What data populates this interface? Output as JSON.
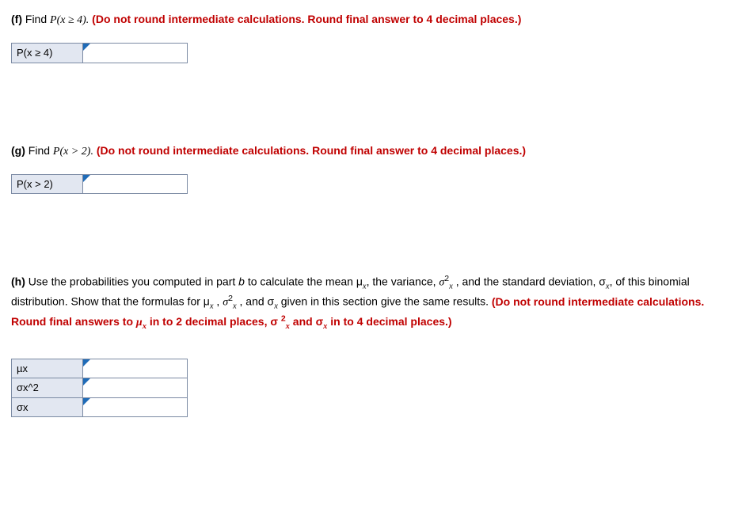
{
  "partF": {
    "label": "(f)",
    "static1": "Find ",
    "expr": "P(x ≥ 4).",
    "instruction": " (Do not round intermediate calculations. Round final answer to 4 decimal places.)",
    "cellLabel": "P(x ≥ 4)",
    "value": ""
  },
  "partG": {
    "label": "(g)",
    "static1": "Find ",
    "expr": "P(x > 2).",
    "instruction": " (Do not round intermediate calculations. Round final answer to 4 decimal places.)",
    "cellLabel": "P(x > 2)",
    "value": ""
  },
  "partH": {
    "label": "(h)",
    "text1": "Use the probabilities you computed in part ",
    "bRef": "b",
    "text2": " to calculate the mean μ",
    "sub_x1": "x",
    "text2b": ", the variance, ",
    "sigma2": "σ",
    "sigma2_sup": "2",
    "sigma2_sub": "x",
    "text3": " , and the standard deviation, σ",
    "sub_x2": "x",
    "text3b": ", of this binomial distribution. Show that the formulas for μ",
    "sub_x3": "x",
    "text4": " , ",
    "sigma2b": "σ",
    "sigma2b_sup": "2",
    "sigma2b_sub": "x",
    "text5": " , and σ",
    "sub_x4": "x",
    "text6": " given in this section give the same results. ",
    "instruction1": "(Do not round intermediate calculations. Round final answers to ",
    "inst_mu": "μ",
    "inst_mu_sub": "x",
    "instruction2": " in to 2 decimal places, σ ",
    "inst_sig2_sup": "2",
    "inst_sig2_sub": "x",
    "instruction3": " and σ",
    "inst_sigx_sub": "x",
    "instruction4": " in to 4 decimal places.)",
    "row1Label": "µx",
    "row2Label": "σx^2",
    "row3Label": "σx",
    "row1Value": "",
    "row2Value": "",
    "row3Value": ""
  }
}
